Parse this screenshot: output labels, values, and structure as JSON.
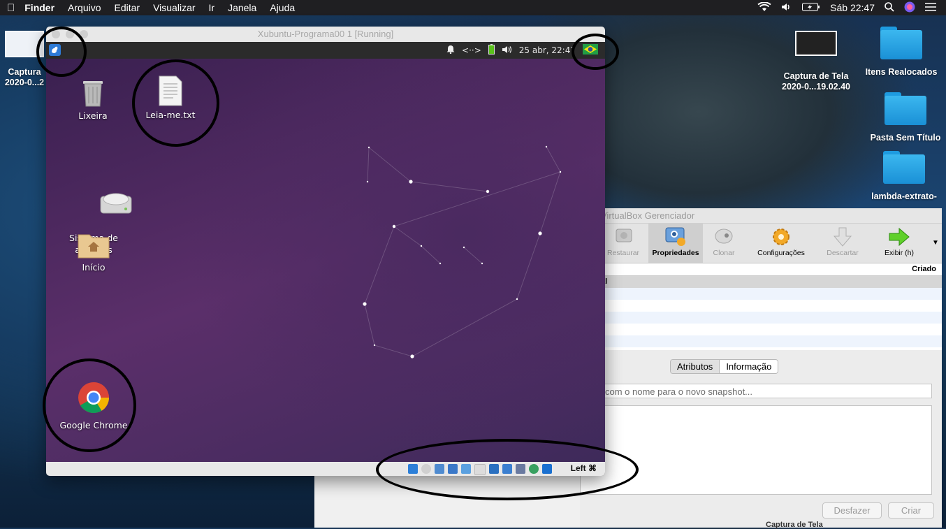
{
  "menubar": {
    "app": "Finder",
    "items": [
      "Arquivo",
      "Editar",
      "Visualizar",
      "Ir",
      "Janela",
      "Ajuda"
    ],
    "clock": "Sáb 22:47"
  },
  "desktop": {
    "icons": [
      {
        "label": "Captura\n2020-0...2"
      },
      {
        "label": "Captura de Tela\n2020-0...19.02.40"
      },
      {
        "label": "Itens Realocados"
      },
      {
        "label": "Pasta Sem Título"
      },
      {
        "label": "lambda-extrato-"
      }
    ]
  },
  "vbox_manager": {
    "title": "VirtualBox Gerenciador",
    "toolbar": [
      {
        "label": "Restaurar",
        "icon": "restore-icon",
        "enabled": false
      },
      {
        "label": "Propriedades",
        "icon": "properties-icon",
        "enabled": true,
        "selected": true
      },
      {
        "label": "Clonar",
        "icon": "clone-icon",
        "enabled": false
      },
      {
        "label": "Configurações",
        "icon": "gear-icon",
        "enabled": true
      },
      {
        "label": "Descartar",
        "icon": "discard-icon",
        "enabled": false
      },
      {
        "label": "Exibir (h)",
        "icon": "show-arrow-icon",
        "enabled": true
      }
    ],
    "list_header": "Criado",
    "list_first_row": "al",
    "tabs": [
      "Atributos",
      "Informação"
    ],
    "snapshot_placeholder": "com o nome para o novo snapshot...",
    "buttons": {
      "undo": "Desfazer",
      "create": "Criar"
    },
    "bottom_cut_text": "Captura de Tela"
  },
  "vm_window": {
    "title": "Xubuntu-Programa00 1 [Running]",
    "panel": {
      "datetime": "25 abr, 22:47"
    },
    "desktop_icons": [
      {
        "label": "Lixeira",
        "icon": "trash-icon"
      },
      {
        "label": "Leia-me.txt",
        "icon": "text-file-icon"
      },
      {
        "label": "Sistema de\narquivos",
        "icon": "drive-icon"
      },
      {
        "label": "Início",
        "icon": "home-folder-icon"
      },
      {
        "label": "Google Chrome",
        "icon": "chrome-icon"
      }
    ],
    "host_key": "Left ⌘"
  },
  "colors": {
    "vm_desktop": "#5b2f6a",
    "mac_menubar": "#1f1f22",
    "folder_blue": "#3bb7ef",
    "annotation": "#000000"
  }
}
